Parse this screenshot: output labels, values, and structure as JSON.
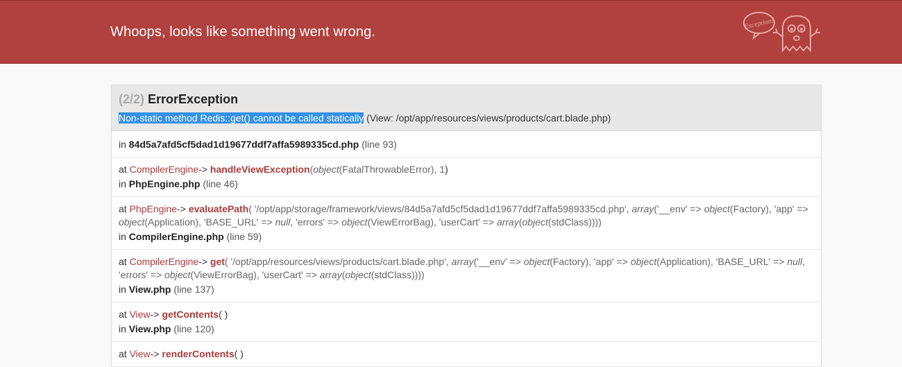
{
  "header": {
    "title": "Whoops, looks like something went wrong.",
    "mascot_label": "Exception!",
    "bg_color": "#b0413e"
  },
  "exception": {
    "count": "(2/2)",
    "type": "ErrorException",
    "message_selected": "Non-static method Redis::get() cannot be called statically",
    "message_rest": " (View: /opt/app/resources/views/products/cart.blade.php)"
  },
  "frames": [
    {
      "in": "in",
      "file": "84d5a7afd5cf5dad1d19677ddf7affa5989335cd.php",
      "line": "(line 93)"
    },
    {
      "at": "at",
      "class": "CompilerEngine",
      "arrow": "->",
      "method": "handleViewException",
      "open": "(",
      "arg1_kw": "object",
      "arg1": "(FatalThrowableError), 1",
      "close": ")",
      "in": "in",
      "file": "PhpEngine.php",
      "line": "(line 46)"
    },
    {
      "at": "at",
      "class": "PhpEngine",
      "arrow": "->",
      "method": "evaluatePath",
      "args_line1_a": "( '/opt/app/storage/framework/views/84d5a7afd5cf5dad1d19677ddf7affa5989335cd.php', ",
      "kw_array": "array",
      "args_line1_b": "('__env' => ",
      "kw_object1": "object",
      "args_line1_c": "(Factory), 'app' =>",
      "kw_object2": "object",
      "args_line2_a": "(Application), 'BASE_URL' => ",
      "kw_null": "null",
      "args_line2_b": ", 'errors' => ",
      "kw_object3": "object",
      "args_line2_c": "(ViewErrorBag), 'userCart' => ",
      "kw_array2": "array",
      "args_line2_d": "(",
      "kw_object4": "object",
      "args_line2_e": "(stdClass))))",
      "in": "in",
      "file": "CompilerEngine.php",
      "line": "(line 59)"
    },
    {
      "at": "at",
      "class": "CompilerEngine",
      "arrow": "->",
      "method": "get",
      "args_line1_a": "( '/opt/app/resources/views/products/cart.blade.php', ",
      "kw_array": "array",
      "args_line1_b": "('__env' => ",
      "kw_object1": "object",
      "args_line1_c": "(Factory), 'app' => ",
      "kw_object2": "object",
      "args_line1_d": "(Application), 'BASE_URL' => ",
      "kw_null": "null",
      "args_line1_e": ",",
      "args_line2_a": "'errors' => ",
      "kw_object3": "object",
      "args_line2_b": "(ViewErrorBag), 'userCart' => ",
      "kw_array2": "array",
      "args_line2_c": "(",
      "kw_object4": "object",
      "args_line2_d": "(stdClass))))",
      "in": "in",
      "file": "View.php",
      "line": "(line 137)"
    },
    {
      "at": "at",
      "class": "View",
      "arrow": "->",
      "method": "getContents",
      "args": "( )",
      "in": "in",
      "file": "View.php",
      "line": "(line 120)"
    },
    {
      "at": "at",
      "class": "View",
      "arrow": "->",
      "method": "renderContents",
      "args": "( )"
    }
  ]
}
